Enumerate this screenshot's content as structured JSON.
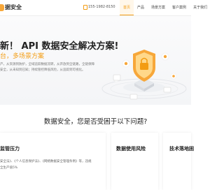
{
  "header": {
    "logo_text": "据安全",
    "phone": "155-1982-8150",
    "nav": [
      "首页",
      "产品",
      "场景方案",
      "客户案例",
      "关于我们"
    ],
    "active_index": 0
  },
  "hero": {
    "title": "新！ API 数据安全解决方案!",
    "subtitle": "台，多场景方案",
    "desc_lines": [
      "产，从资源到防护，全域追踪数据流转，从开放到全链路，全链保障",
      "安全，从未知到已知；持续管控降低风险，从追踪到可视化。"
    ]
  },
  "section": {
    "title": "数据安全，您是否受困于以下问题?"
  },
  "cards": [
    {
      "title": "监管压力",
      "lines": [
        "安全法》、《个人信息保护法》、《网络数据安全管理条例》等，违规",
        "全生产值5%"
      ]
    },
    {
      "title": "数据使用风险",
      "lines": []
    },
    {
      "title": "技术落地困",
      "lines": []
    }
  ],
  "colors": {
    "accent": "#f39c12",
    "accent_light": "#fff7ea"
  }
}
